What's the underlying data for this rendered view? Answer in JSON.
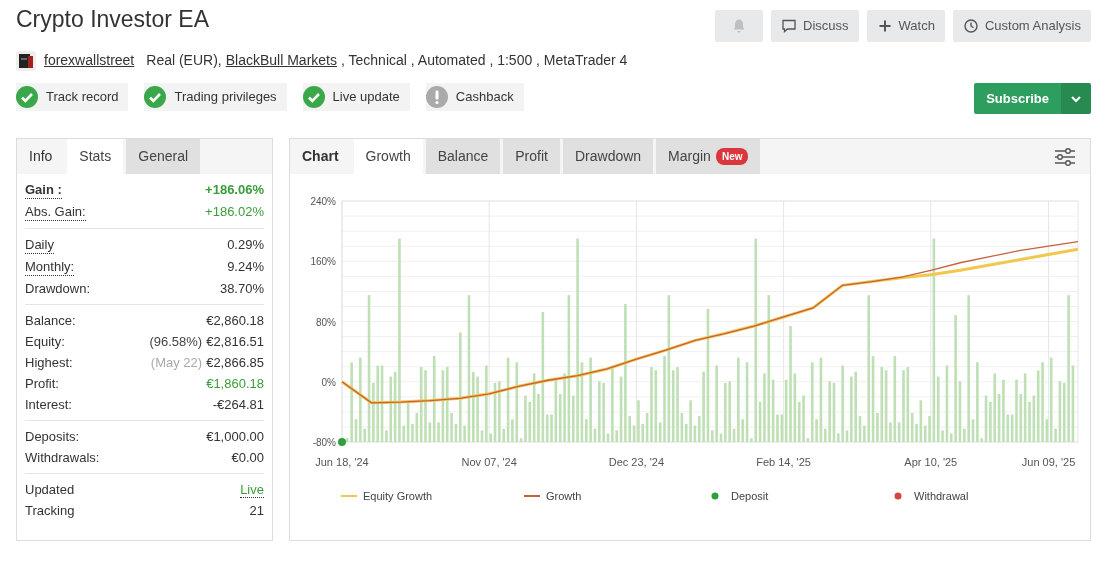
{
  "title": "Crypto Investor EA",
  "header_buttons": [
    {
      "kind": "bell",
      "disabled": true
    },
    {
      "kind": "discuss",
      "label": "Discuss",
      "disabled": false
    },
    {
      "kind": "watch",
      "label": "Watch",
      "disabled": false
    },
    {
      "kind": "clock",
      "label": "Custom Analysis",
      "disabled": false
    }
  ],
  "account": {
    "owner": "forexwallstreet",
    "details": [
      {
        "kind": "text",
        "text": "Real (EUR),"
      },
      {
        "kind": "link",
        "text": "BlackBull Markets"
      },
      {
        "kind": "text",
        "text": ", Technical , Automated , 1:500 , MetaTrader 4"
      }
    ]
  },
  "badges": [
    {
      "label": "Track record",
      "verified": true
    },
    {
      "label": "Trading privileges",
      "verified": true
    },
    {
      "label": "Live update",
      "verified": true
    },
    {
      "label": "Cashback",
      "verified": false
    }
  ],
  "subscribe": {
    "label": "Subscribe"
  },
  "stats_panel": {
    "heading": "Info",
    "tabs": [
      {
        "label": "Stats",
        "selected": true
      },
      {
        "label": "General",
        "selected": false
      }
    ],
    "groups": [
      [
        {
          "label": "Gain :",
          "value": "+186.06%",
          "bold": true,
          "label_dotted": true,
          "value_dotted": false,
          "positive": true
        },
        {
          "label": "Abs. Gain:",
          "value": "+186.02%",
          "bold": false,
          "label_dotted": true,
          "value_dotted": false,
          "positive": true
        }
      ],
      [
        {
          "label": "Daily",
          "value": "0.29%",
          "bold": false,
          "label_dotted": true,
          "value_dotted": false,
          "positive": false
        },
        {
          "label": "Monthly:",
          "value": "9.24%",
          "bold": false,
          "label_dotted": true,
          "value_dotted": false,
          "positive": false
        },
        {
          "label": "Drawdown:",
          "value": "38.70%",
          "bold": false,
          "label_dotted": false,
          "value_dotted": false,
          "positive": false
        }
      ],
      [
        {
          "label": "Balance:",
          "value": "€2,860.18",
          "bold": false,
          "label_dotted": false,
          "value_dotted": false,
          "positive": false
        },
        {
          "label": "Equity:",
          "note": "(96.58%)",
          "note_muted": false,
          "value": "€2,816.51",
          "bold": false,
          "label_dotted": false,
          "value_dotted": false,
          "positive": false
        },
        {
          "label": "Highest:",
          "note": "(May 22)",
          "note_muted": true,
          "value": "€2,866.85",
          "bold": false,
          "label_dotted": false,
          "value_dotted": false,
          "positive": false
        },
        {
          "label": "Profit:",
          "value": "€1,860.18",
          "bold": false,
          "label_dotted": false,
          "value_dotted": false,
          "positive": true
        },
        {
          "label": "Interest:",
          "value": "-€264.81",
          "bold": false,
          "label_dotted": false,
          "value_dotted": false,
          "positive": false
        }
      ],
      [
        {
          "label": "Deposits:",
          "value": "€1,000.00",
          "bold": false,
          "label_dotted": false,
          "value_dotted": false,
          "positive": false
        },
        {
          "label": "Withdrawals:",
          "value": "€0.00",
          "bold": false,
          "label_dotted": false,
          "value_dotted": false,
          "positive": false
        }
      ],
      [
        {
          "label": "Updated",
          "value": "Live",
          "bold": false,
          "label_dotted": false,
          "value_dotted": true,
          "positive": true
        },
        {
          "label": "Tracking",
          "value": "21",
          "bold": false,
          "label_dotted": false,
          "value_dotted": false,
          "positive": false
        }
      ]
    ]
  },
  "chart_panel": {
    "heading": "Chart",
    "tabs": [
      {
        "label": "Growth",
        "selected": true
      },
      {
        "label": "Balance",
        "selected": false
      },
      {
        "label": "Profit",
        "selected": false
      },
      {
        "label": "Drawdown",
        "selected": false
      },
      {
        "label": "Margin",
        "badge": "New",
        "selected": false
      }
    ],
    "chart_data": {
      "type": "line",
      "grid": true,
      "legend": "bottom",
      "categories": [
        "Jun 18, '24",
        null,
        null,
        null,
        null,
        "Nov 07, '24",
        null,
        null,
        null,
        null,
        "Dec 23, '24",
        null,
        null,
        null,
        null,
        "Feb 14, '25",
        null,
        null,
        null,
        null,
        "Apr 10, '25",
        null,
        null,
        null,
        "Jun 09, '25",
        null
      ],
      "ylim": [
        -80,
        240
      ],
      "yticks": [
        {
          "value": -80,
          "label": "-80%"
        },
        {
          "value": 0,
          "label": "0%"
        },
        {
          "value": 80,
          "label": "80%"
        },
        {
          "value": 160,
          "label": "160%"
        },
        {
          "value": 240,
          "label": "240%"
        }
      ],
      "series": [
        {
          "name": "Equity Growth",
          "color": "#f0c850",
          "values": [
            0,
            -28,
            -27,
            -25,
            -22,
            -16,
            -6,
            2,
            8,
            17,
            30,
            42,
            55,
            64,
            74,
            86,
            98,
            128,
            133,
            138,
            142,
            148,
            155,
            162,
            169,
            176
          ]
        },
        {
          "name": "Growth",
          "color": "#c8603c",
          "values": [
            0,
            -28,
            -27,
            -25,
            -22,
            -16,
            -6,
            2,
            8,
            17,
            30,
            42,
            55,
            64,
            74,
            86,
            98,
            128,
            133,
            139,
            148,
            158,
            166,
            174,
            180,
            186
          ]
        },
        {
          "name": "Deposit",
          "color": "#2e9e3e",
          "marker": true,
          "values": [
            -80,
            null,
            null,
            null,
            null,
            null,
            null,
            null,
            null,
            null,
            null,
            null,
            null,
            null,
            null,
            null,
            null,
            null,
            null,
            null,
            null,
            null,
            null,
            null,
            null,
            null
          ]
        },
        {
          "name": "Withdrawal",
          "color": "#d9443a",
          "marker": true,
          "values": [
            null,
            null,
            null,
            null,
            null,
            null,
            null,
            null,
            null,
            null,
            null,
            null,
            null,
            null,
            null,
            null,
            null,
            null,
            null,
            null,
            null,
            null,
            null,
            null,
            null,
            null
          ]
        }
      ]
    }
  }
}
